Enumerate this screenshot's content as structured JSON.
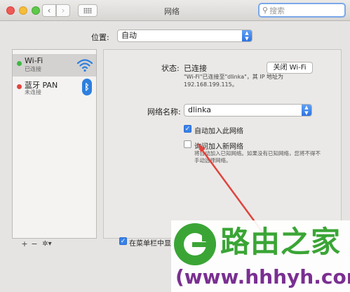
{
  "window": {
    "title": "网络",
    "search_placeholder": "搜索"
  },
  "toolbar": {
    "back_icon": "chevron-left-icon",
    "forward_icon": "chevron-right-icon",
    "show_all_icon": "grid-icon"
  },
  "location": {
    "label": "位置:",
    "value": "自动"
  },
  "sidebar": {
    "items": [
      {
        "name": "Wi-Fi",
        "status": "已连接",
        "status_color": "#3cb944",
        "icon": "wifi-icon"
      },
      {
        "name": "蓝牙 PAN",
        "status": "未连接",
        "status_color": "#e0443d",
        "icon": "bluetooth-icon"
      }
    ],
    "tools": {
      "add": "+",
      "remove": "−",
      "gear": "✲▾"
    }
  },
  "detail": {
    "status_label": "状态:",
    "status_value": "已连接",
    "wifi_off_button": "关闭 Wi-Fi",
    "status_description": "\"Wi-Fi\"已连接至\"dlinka\"，其 IP 地址为 192.168.199.115。",
    "network_name_label": "网络名称:",
    "network_name_value": "dlinka",
    "auto_join_label": "自动加入此网络",
    "auto_join_checked": true,
    "ask_join_label": "询问加入新网络",
    "ask_join_checked": false,
    "ask_join_description": "将自动加入已知网络。如果没有已知网络，您将不得不手动选择网络。",
    "menubar_label": "在菜单栏中显示",
    "menubar_checked": true
  },
  "watermark": {
    "title": "路由之家",
    "url": "(www.hhhyh.com)"
  },
  "colors": {
    "accent": "#3a82e8",
    "watermark_green": "#3aa535",
    "watermark_purple": "#7a2f91",
    "annotation_red": "#e0443d"
  }
}
